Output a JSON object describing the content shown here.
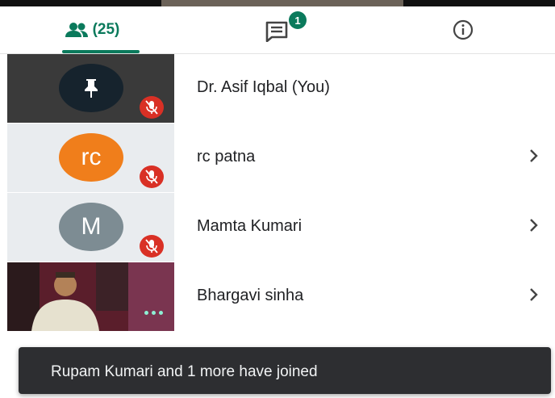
{
  "tabs": {
    "people": {
      "icon": "people-icon",
      "count": "(25)"
    },
    "chat": {
      "icon": "chat-icon",
      "badge": "1"
    },
    "info": {
      "icon": "info-icon"
    }
  },
  "participants": [
    {
      "name": "Dr. Asif Iqbal (You)",
      "avatar": "pin-icon",
      "muted": true
    },
    {
      "name": "rc patna",
      "avatar_initials": "rc",
      "avatar_color": "#f07e1b",
      "muted": true
    },
    {
      "name": "Mamta Kumari",
      "avatar_initials": "M",
      "avatar_color": "#7d8c93",
      "muted": true
    },
    {
      "name": "Bhargavi sinha",
      "video": true
    }
  ],
  "toast": {
    "message": "Rupam Kumari and 1 more have joined"
  },
  "colors": {
    "accent": "#0b7a5c",
    "mute": "#d93025",
    "toast_bg": "#2d2e31"
  }
}
